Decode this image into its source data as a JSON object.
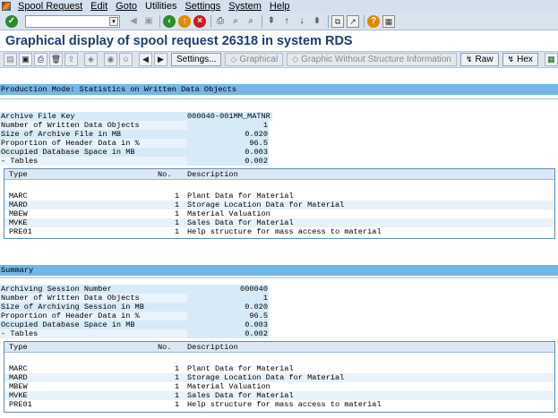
{
  "menu": {
    "items": [
      "Spool Request",
      "Edit",
      "Goto",
      "Utilities",
      "Settings",
      "System",
      "Help"
    ]
  },
  "stdbar": {
    "command_value": "",
    "icons": [
      "enter-icon",
      "back-icon",
      "exit-icon",
      "cancel-icon",
      "print-icon",
      "find-icon",
      "find-next-icon",
      "first-page-icon",
      "previous-page-icon",
      "next-page-icon",
      "last-page-icon",
      "create-session-icon",
      "shortcut-icon",
      "help-icon",
      "layout-icon"
    ]
  },
  "title": "Graphical display of spool request 26318 in system RDS",
  "appbar": {
    "settings": "Settings...",
    "graphical": "Graphical",
    "graphic_without_structure": "Graphic Without Structure Information",
    "raw": "Raw",
    "hex": "Hex"
  },
  "section1": {
    "header": "Production Mode: Statistics on Written Data Objects",
    "fields": [
      {
        "key": "Archive File Key",
        "value": "000040-001MM_MATNR"
      },
      {
        "key": "Number of Written Data Objects",
        "value": "1"
      },
      {
        "key": "Size of Archive File in MB",
        "value": "0.020"
      },
      {
        "key": "Proportion of Header Data in %",
        "value": "96.5"
      },
      {
        "key": "Occupied Database Space in MB",
        "value": "0.003"
      },
      {
        "key": "- Tables",
        "value": "0.002"
      }
    ],
    "table": {
      "headers": [
        "Type",
        "No.",
        "Description"
      ],
      "rows": [
        {
          "type": "MARC",
          "no": "1",
          "desc": "Plant Data for Material"
        },
        {
          "type": "MARD",
          "no": "1",
          "desc": "Storage Location Data for Material"
        },
        {
          "type": "MBEW",
          "no": "1",
          "desc": "Material Valuation"
        },
        {
          "type": "MVKE",
          "no": "1",
          "desc": "Sales Data for Material"
        },
        {
          "type": "PRE01",
          "no": "1",
          "desc": "Help structure for mass access to material"
        }
      ]
    }
  },
  "section2": {
    "header": "Summary",
    "fields": [
      {
        "key": "Archiving Session Number",
        "value": "000040"
      },
      {
        "key": "Number of Written Data Objects",
        "value": "1"
      },
      {
        "key": "Size of Archiving Session in MB",
        "value": "0.020"
      },
      {
        "key": "Proportion of Header Data in %",
        "value": "96.5"
      },
      {
        "key": "Occupied Database Space in MB",
        "value": "0.003"
      },
      {
        "key": "- Tables",
        "value": "0.002"
      }
    ],
    "table": {
      "headers": [
        "Type",
        "No.",
        "Description"
      ],
      "rows": [
        {
          "type": "MARC",
          "no": "1",
          "desc": "Plant Data for Material"
        },
        {
          "type": "MARD",
          "no": "1",
          "desc": "Storage Location Data for Material"
        },
        {
          "type": "MBEW",
          "no": "1",
          "desc": "Material Valuation"
        },
        {
          "type": "MVKE",
          "no": "1",
          "desc": "Sales Data for Material"
        },
        {
          "type": "PRE01",
          "no": "1",
          "desc": "Help structure for mass access to material"
        }
      ]
    }
  },
  "colors": {
    "title": "#1d3e6e",
    "band": "#72b7e6",
    "row": "#d7eaf7"
  }
}
